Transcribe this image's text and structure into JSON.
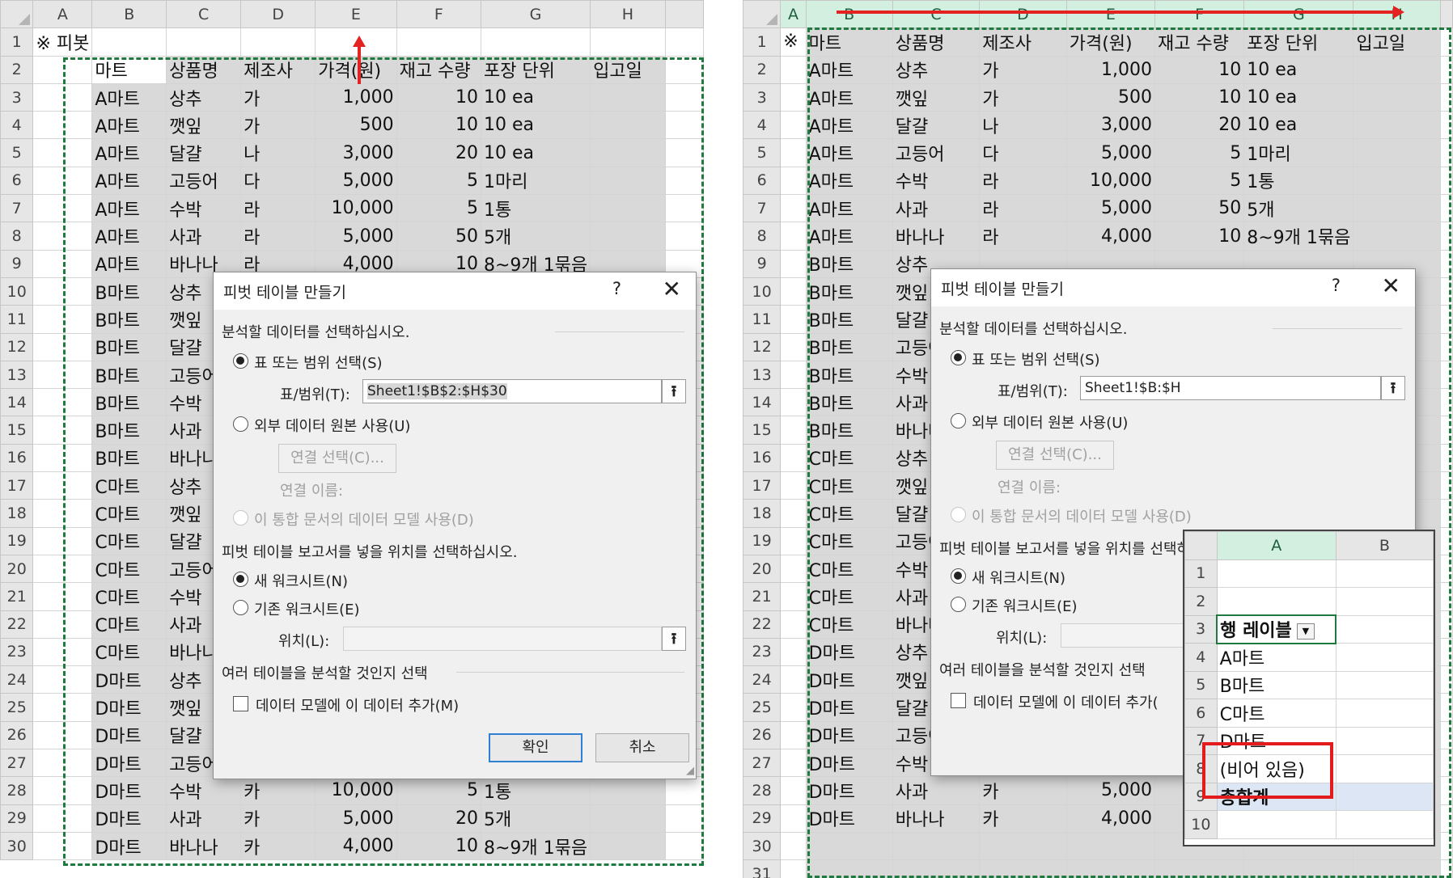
{
  "colors": {
    "selection_marquee": "#1f7a3f",
    "annotation_red": "#e52222",
    "range_fill": "#d9d9d9"
  },
  "icons": {
    "range_picker": "upload-arrow-icon",
    "close": "close-icon",
    "help": "help-icon",
    "dropdown": "filter-dropdown-icon"
  },
  "left": {
    "column_headers": [
      "A",
      "B",
      "C",
      "D",
      "E",
      "F",
      "G",
      "H"
    ],
    "title_cell": "※ 피봇",
    "table_headers": [
      "마트",
      "상품명",
      "제조사",
      "가격(원)",
      "재고 수량",
      "포장 단위",
      "입고일"
    ],
    "rows": [
      [
        "A마트",
        "상추",
        "가",
        "1,000",
        "10",
        "10 ea",
        ""
      ],
      [
        "A마트",
        "깻잎",
        "가",
        "500",
        "10",
        "10 ea",
        ""
      ],
      [
        "A마트",
        "달걀",
        "나",
        "3,000",
        "20",
        "10 ea",
        ""
      ],
      [
        "A마트",
        "고등어",
        "다",
        "5,000",
        "5",
        "1마리",
        ""
      ],
      [
        "A마트",
        "수박",
        "라",
        "10,000",
        "5",
        "1통",
        ""
      ],
      [
        "A마트",
        "사과",
        "라",
        "5,000",
        "50",
        "5개",
        ""
      ],
      [
        "A마트",
        "바나나",
        "라",
        "4,000",
        "10",
        "8~9개 1묶음",
        ""
      ],
      [
        "B마트",
        "상추",
        "",
        "",
        "",
        "",
        ""
      ],
      [
        "B마트",
        "깻잎",
        "",
        "",
        "",
        "",
        ""
      ],
      [
        "B마트",
        "달걀",
        "",
        "",
        "",
        "",
        ""
      ],
      [
        "B마트",
        "고등어",
        "",
        "",
        "",
        "",
        ""
      ],
      [
        "B마트",
        "수박",
        "",
        "",
        "",
        "",
        ""
      ],
      [
        "B마트",
        "사과",
        "",
        "",
        "",
        "",
        ""
      ],
      [
        "B마트",
        "바나나",
        "",
        "",
        "",
        "",
        ""
      ],
      [
        "C마트",
        "상추",
        "",
        "",
        "",
        "",
        ""
      ],
      [
        "C마트",
        "깻잎",
        "",
        "",
        "",
        "",
        ""
      ],
      [
        "C마트",
        "달걀",
        "",
        "",
        "",
        "",
        ""
      ],
      [
        "C마트",
        "고등어",
        "",
        "",
        "",
        "",
        ""
      ],
      [
        "C마트",
        "수박",
        "",
        "",
        "",
        "",
        ""
      ],
      [
        "C마트",
        "사과",
        "",
        "",
        "",
        "",
        ""
      ],
      [
        "C마트",
        "바나나",
        "",
        "",
        "",
        "",
        ""
      ],
      [
        "D마트",
        "상추",
        "",
        "",
        "",
        "",
        ""
      ],
      [
        "D마트",
        "깻잎",
        "",
        "",
        "",
        "",
        ""
      ],
      [
        "D마트",
        "달걀",
        "",
        "",
        "",
        "",
        ""
      ],
      [
        "D마트",
        "고등어",
        "",
        "",
        "",
        "",
        ""
      ],
      [
        "D마트",
        "수박",
        "카",
        "10,000",
        "5",
        "1통",
        ""
      ],
      [
        "D마트",
        "사과",
        "카",
        "5,000",
        "20",
        "5개",
        ""
      ],
      [
        "D마트",
        "바나나",
        "카",
        "4,000",
        "10",
        "8~9개 1묶음",
        ""
      ]
    ],
    "dialog": {
      "title": "피벗 테이블 만들기",
      "help": "?",
      "close": "✕",
      "section1": "분석할 데이터를 선택하십시오.",
      "opt_table": "표 또는 범위 선택(S)",
      "range_label": "표/범위(T):",
      "range_value": "Sheet1!$B$2:$H$30",
      "opt_external": "외부 데이터 원본 사용(U)",
      "btn_connection": "연결 선택(C)...",
      "conn_name_label": "연결 이름:",
      "opt_datamodel": "이 통합 문서의 데이터 모델 사용(D)",
      "section2": "피벗 테이블 보고서를 넣을 위치를 선택하십시오.",
      "opt_new_sheet": "새 워크시트(N)",
      "opt_existing": "기존 워크시트(E)",
      "location_label": "위치(L):",
      "location_value": "",
      "section3": "여러 테이블을 분석할 것인지 선택",
      "chk_add_model": "데이터 모델에 이 데이터 추가(M)",
      "ok": "확인",
      "cancel": "취소"
    }
  },
  "right": {
    "column_headers": [
      "A",
      "B",
      "C",
      "D",
      "E",
      "F",
      "G",
      "H"
    ],
    "title_cell": "※",
    "table_headers": [
      "마트",
      "상품명",
      "제조사",
      "가격(원)",
      "재고 수량",
      "포장 단위",
      "입고일"
    ],
    "rows": [
      [
        "A마트",
        "상추",
        "가",
        "1,000",
        "10",
        "10 ea",
        ""
      ],
      [
        "A마트",
        "깻잎",
        "가",
        "500",
        "10",
        "10 ea",
        ""
      ],
      [
        "A마트",
        "달걀",
        "나",
        "3,000",
        "20",
        "10 ea",
        ""
      ],
      [
        "A마트",
        "고등어",
        "다",
        "5,000",
        "5",
        "1마리",
        ""
      ],
      [
        "A마트",
        "수박",
        "라",
        "10,000",
        "5",
        "1통",
        ""
      ],
      [
        "A마트",
        "사과",
        "라",
        "5,000",
        "50",
        "5개",
        ""
      ],
      [
        "A마트",
        "바나나",
        "라",
        "4,000",
        "10",
        "8~9개 1묶음",
        ""
      ],
      [
        "B마트",
        "상추",
        "",
        "",
        "",
        "",
        ""
      ],
      [
        "B마트",
        "깻잎",
        "",
        "",
        "",
        "",
        ""
      ],
      [
        "B마트",
        "달걀",
        "",
        "",
        "",
        "",
        ""
      ],
      [
        "B마트",
        "고등어",
        "",
        "",
        "",
        "",
        ""
      ],
      [
        "B마트",
        "수박",
        "",
        "",
        "",
        "",
        ""
      ],
      [
        "B마트",
        "사과",
        "",
        "",
        "",
        "",
        ""
      ],
      [
        "B마트",
        "바나나",
        "",
        "",
        "",
        "",
        ""
      ],
      [
        "C마트",
        "상추",
        "",
        "",
        "",
        "",
        ""
      ],
      [
        "C마트",
        "깻잎",
        "",
        "",
        "",
        "",
        ""
      ],
      [
        "C마트",
        "달걀",
        "",
        "",
        "",
        "",
        ""
      ],
      [
        "C마트",
        "고등어",
        "",
        "",
        "",
        "",
        ""
      ],
      [
        "C마트",
        "수박",
        "",
        "",
        "",
        "",
        ""
      ],
      [
        "C마트",
        "사과",
        "",
        "",
        "",
        "",
        ""
      ],
      [
        "C마트",
        "바나나",
        "",
        "",
        "",
        "",
        ""
      ],
      [
        "D마트",
        "상추",
        "",
        "",
        "",
        "",
        ""
      ],
      [
        "D마트",
        "깻잎",
        "",
        "",
        "",
        "",
        ""
      ],
      [
        "D마트",
        "달걀",
        "",
        "",
        "",
        "",
        ""
      ],
      [
        "D마트",
        "고등어",
        "",
        "",
        "",
        "",
        ""
      ],
      [
        "D마트",
        "수박",
        "",
        "",
        "",
        "",
        ""
      ],
      [
        "D마트",
        "사과",
        "카",
        "5,000",
        "",
        "",
        ""
      ],
      [
        "D마트",
        "바나나",
        "카",
        "4,000",
        "",
        "",
        ""
      ]
    ],
    "dialog": {
      "title": "피벗 테이블 만들기",
      "help": "?",
      "close": "✕",
      "section1": "분석할 데이터를 선택하십시오.",
      "opt_table": "표 또는 범위 선택(S)",
      "range_label": "표/범위(T):",
      "range_value": "Sheet1!$B:$H",
      "opt_external": "외부 데이터 원본 사용(U)",
      "btn_connection": "연결 선택(C)...",
      "conn_name_label": "연결 이름:",
      "opt_datamodel": "이 통합 문서의 데이터 모델 사용(D)",
      "section2": "피벗 테이블 보고서를 넣을 위치를 선택하",
      "opt_new_sheet": "새 워크시트(N)",
      "opt_existing": "기존 워크시트(E)",
      "location_label": "위치(L):",
      "section3": "여러 테이블을 분석할 것인지 선택",
      "chk_add_model": "데이터 모델에 이 데이터 추가("
    },
    "inset": {
      "col_a": "A",
      "col_b": "B",
      "row_numbers": [
        "1",
        "2",
        "3",
        "4",
        "5",
        "6",
        "7",
        "8",
        "9",
        "10"
      ],
      "row_label_header": "행 레이블",
      "items": [
        "A마트",
        "B마트",
        "C마트",
        "D마트",
        "(비어 있음)"
      ],
      "grand_total": "총합계"
    }
  }
}
